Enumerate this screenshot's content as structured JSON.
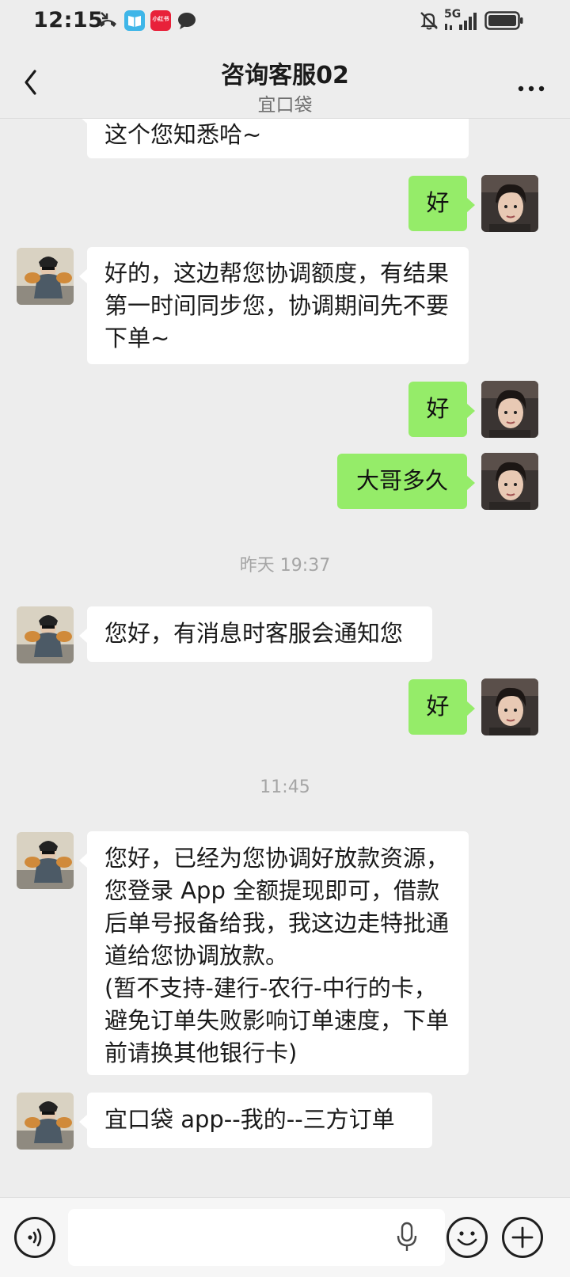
{
  "status_bar": {
    "time": "12:15",
    "notification_icons": [
      "missed-call-icon",
      "book-app-icon",
      "xiaohongshu-app-icon",
      "message-icon"
    ],
    "xiaohongshu_text": "小红书",
    "network": "5G",
    "system_icons": [
      "mute-bell-icon",
      "signal-icon",
      "battery-icon"
    ]
  },
  "header": {
    "title": "咨询客服02",
    "subtitle": "宜口袋",
    "back_icon": "chevron-left-icon",
    "more_icon": "more-icon"
  },
  "messages": [
    {
      "side": "in",
      "text": "这个您知悉哈~"
    },
    {
      "side": "out",
      "text": "好"
    },
    {
      "side": "in",
      "text": "好的，这边帮您协调额度，有结果\n第一时间同步您，协调期间先不要\n下单~"
    },
    {
      "side": "out",
      "text": "好"
    },
    {
      "side": "out",
      "text": "大哥多久"
    },
    {
      "side": "in",
      "text": "您好，有消息时客服会通知您"
    },
    {
      "side": "out",
      "text": "好"
    },
    {
      "side": "in",
      "text": "您好，已经为您协调好放款资源，\n您登录 App 全额提现即可，借款\n后单号报备给我，我这边走特批通\n道给您协调放款。\n(暂不支持-建行-农行-中行的卡，\n避免订单失败影响订单速度，下单\n前请换其他银行卡)"
    },
    {
      "side": "in",
      "text": "宜口袋 app--我的--三方订单"
    }
  ],
  "timestamps": [
    "昨天 19:37",
    "11:45"
  ],
  "input_bar": {
    "icons": [
      "voice-icon",
      "microphone-icon",
      "emoji-icon",
      "plus-icon"
    ],
    "value": ""
  },
  "colors": {
    "background": "#ededed",
    "outgoing_bubble": "#95ec69",
    "incoming_bubble": "#ffffff",
    "timestamp_text": "#a5a5a5"
  }
}
